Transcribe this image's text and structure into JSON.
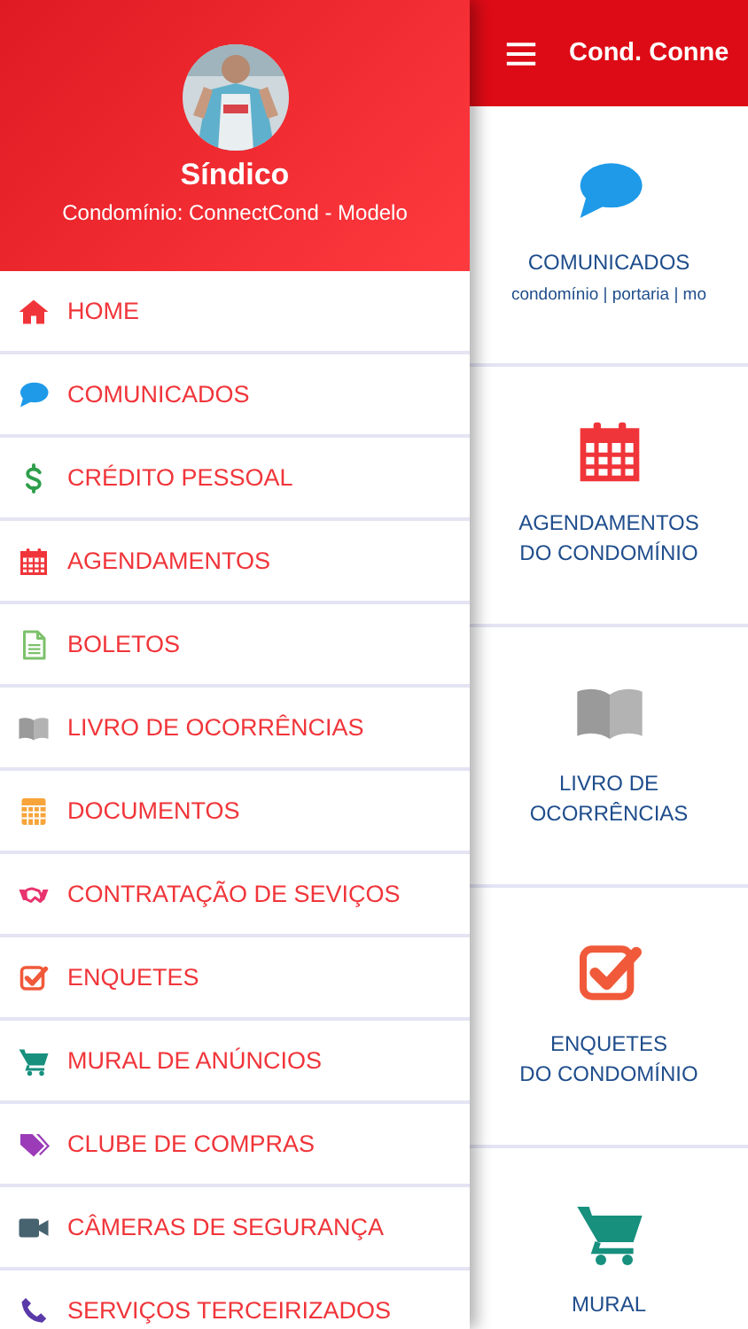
{
  "drawer": {
    "header": {
      "name": "Síndico",
      "subtitle": "Condomínio: ConnectCond - Modelo"
    },
    "items": [
      {
        "label": "HOME",
        "kind": "home",
        "color": "#f0353a"
      },
      {
        "label": "COMUNICADOS",
        "kind": "chat",
        "color": "#1e9ae8"
      },
      {
        "label": "CRÉDITO PESSOAL",
        "kind": "dollar",
        "color": "#2e9e4a"
      },
      {
        "label": "AGENDAMENTOS",
        "kind": "calendar",
        "color": "#f0353a"
      },
      {
        "label": "BOLETOS",
        "kind": "document",
        "color": "#7cc16b"
      },
      {
        "label": "LIVRO DE OCORRÊNCIAS",
        "kind": "book",
        "color": "#9a9a9a"
      },
      {
        "label": "DOCUMENTOS",
        "kind": "calculator",
        "color": "#f7a43b"
      },
      {
        "label": "CONTRATAÇÃO DE SEVIÇOS",
        "kind": "handshake",
        "color": "#e8336e"
      },
      {
        "label": "ENQUETES",
        "kind": "check",
        "color": "#f05a3a"
      },
      {
        "label": "MURAL DE ANÚNCIOS",
        "kind": "cart",
        "color": "#17907e"
      },
      {
        "label": "CLUBE DE COMPRAS",
        "kind": "tags",
        "color": "#9b3bb8"
      },
      {
        "label": "CÂMERAS DE SEGURANÇA",
        "kind": "camera",
        "color": "#46636f"
      },
      {
        "label": "SERVIÇOS TERCEIRIZADOS",
        "kind": "phone",
        "color": "#5a3aa8"
      }
    ]
  },
  "main": {
    "topbar": {
      "title": "Cond. Conne"
    },
    "cards": [
      {
        "kind": "chat",
        "color": "#1e9ae8",
        "title": [
          "COMUNICADOS"
        ],
        "subtitle": "condomínio | portaria | mo"
      },
      {
        "kind": "calendar",
        "color": "#f0353a",
        "title": [
          "AGENDAMENTOS",
          "DO CONDOMÍNIO"
        ]
      },
      {
        "kind": "book",
        "color": "#9a9a9a",
        "title": [
          "LIVRO DE",
          "OCORRÊNCIAS"
        ]
      },
      {
        "kind": "check",
        "color": "#f05a3a",
        "title": [
          "ENQUETES",
          "DO CONDOMÍNIO"
        ]
      },
      {
        "kind": "cart",
        "color": "#17907e",
        "title": [
          "MURAL"
        ]
      }
    ]
  }
}
